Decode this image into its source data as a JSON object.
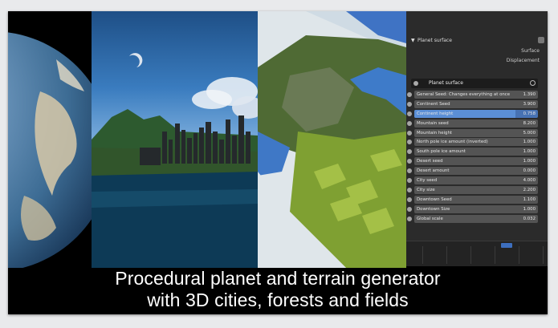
{
  "caption": {
    "line1": "Procedural planet and terrain generator",
    "line2": "with 3D cities, forests and fields"
  },
  "panel": {
    "section_title": "Planet surface",
    "outputs": [
      "Surface",
      "Displacement"
    ],
    "node_name": "Planet surface",
    "params": [
      {
        "label": "General Seed: Changes everything at once",
        "value": "1.390",
        "active": false
      },
      {
        "label": "Continent Seed",
        "value": "3.900",
        "active": false
      },
      {
        "label": "Continent height",
        "value": "0.758",
        "active": true,
        "fill": 0.82
      },
      {
        "label": "Mountain seed",
        "value": "8.200",
        "active": false
      },
      {
        "label": "Mountain height",
        "value": "5.000",
        "active": false
      },
      {
        "label": "North pole ice amount (inverted)",
        "value": "1.000",
        "active": false
      },
      {
        "label": "South pole ice amount",
        "value": "1.000",
        "active": false
      },
      {
        "label": "Desert seed",
        "value": "1.000",
        "active": false
      },
      {
        "label": "Desert amount",
        "value": "0.000",
        "active": false
      },
      {
        "label": "City seed",
        "value": "4.000",
        "active": false
      },
      {
        "label": "City size",
        "value": "2.200",
        "active": false
      },
      {
        "label": "Downtown Seed",
        "value": "1.100",
        "active": false
      },
      {
        "label": "Downtown Size",
        "value": "1.000",
        "active": false
      },
      {
        "label": "Global scale",
        "value": "0.032",
        "active": false
      }
    ]
  },
  "colors": {
    "active_field": "#4772b3",
    "field": "#545454",
    "panel_bg": "#2b2b2b"
  }
}
